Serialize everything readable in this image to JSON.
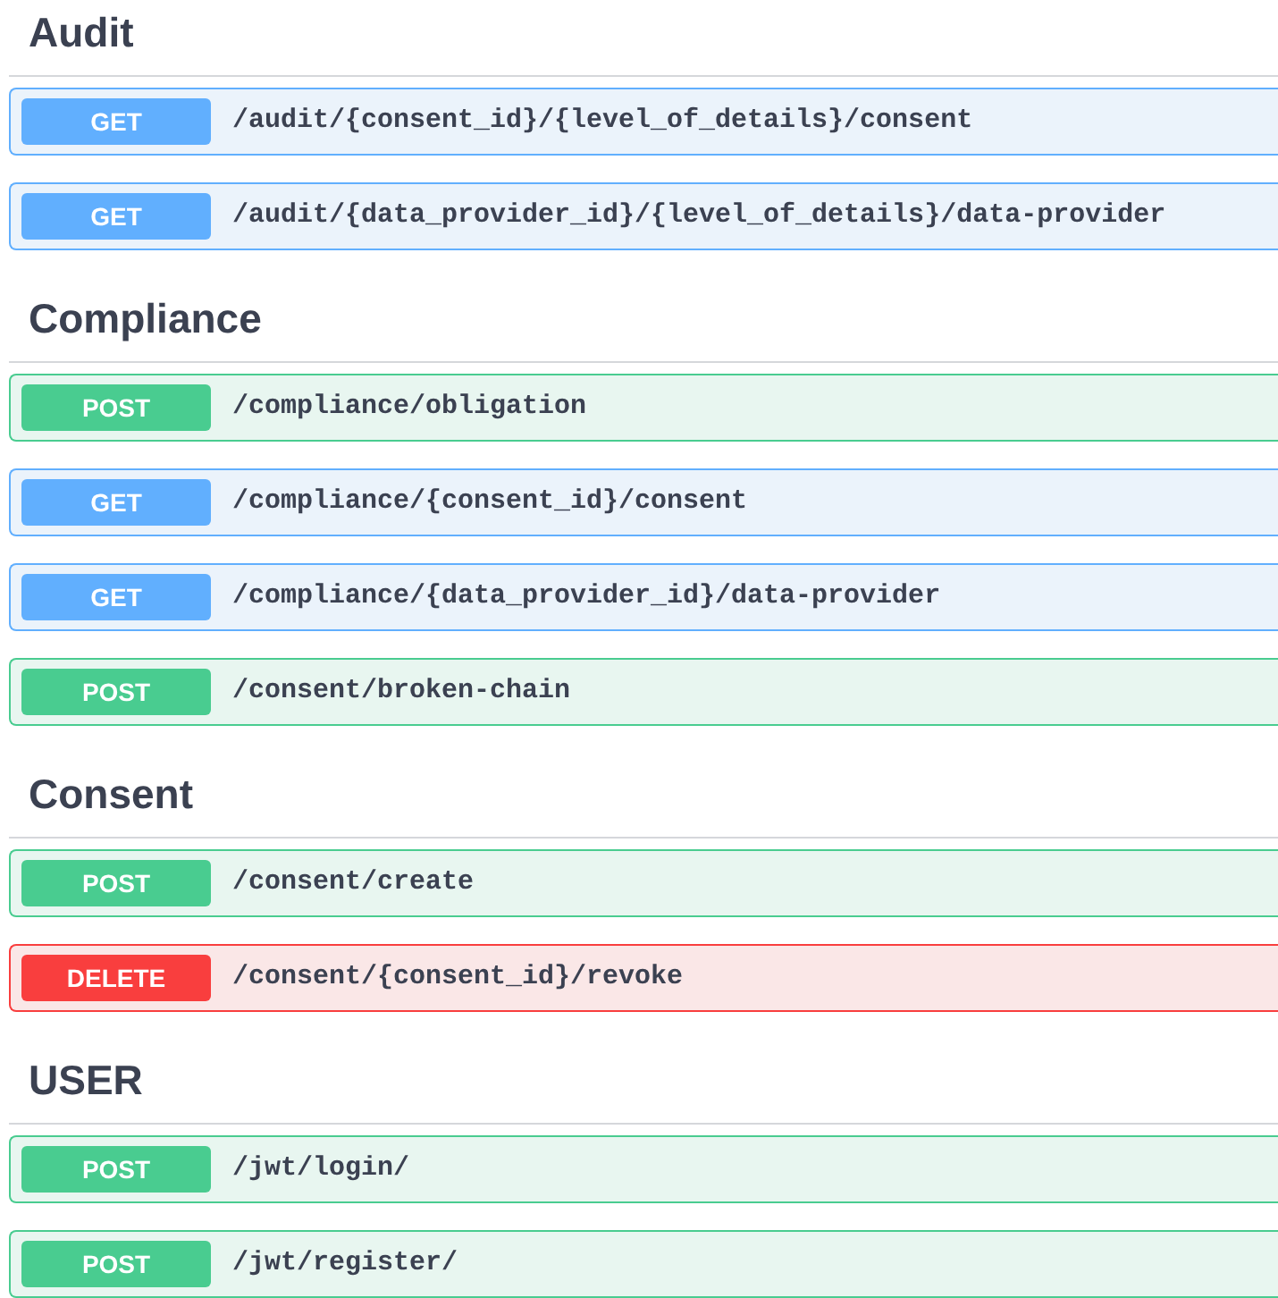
{
  "sections": [
    {
      "title": "Audit",
      "operations": [
        {
          "method": "GET",
          "path": "/audit/{consent_id}/{level_of_details}/consent"
        },
        {
          "method": "GET",
          "path": "/audit/{data_provider_id}/{level_of_details}/data-provider"
        }
      ]
    },
    {
      "title": "Compliance",
      "operations": [
        {
          "method": "POST",
          "path": "/compliance/obligation"
        },
        {
          "method": "GET",
          "path": "/compliance/{consent_id}/consent"
        },
        {
          "method": "GET",
          "path": "/compliance/{data_provider_id}/data-provider"
        },
        {
          "method": "POST",
          "path": "/consent/broken-chain"
        }
      ]
    },
    {
      "title": "Consent",
      "operations": [
        {
          "method": "POST",
          "path": "/consent/create"
        },
        {
          "method": "DELETE",
          "path": "/consent/{consent_id}/revoke"
        }
      ]
    },
    {
      "title": "USER",
      "operations": [
        {
          "method": "POST",
          "path": "/jwt/login/"
        },
        {
          "method": "POST",
          "path": "/jwt/register/"
        }
      ]
    }
  ]
}
